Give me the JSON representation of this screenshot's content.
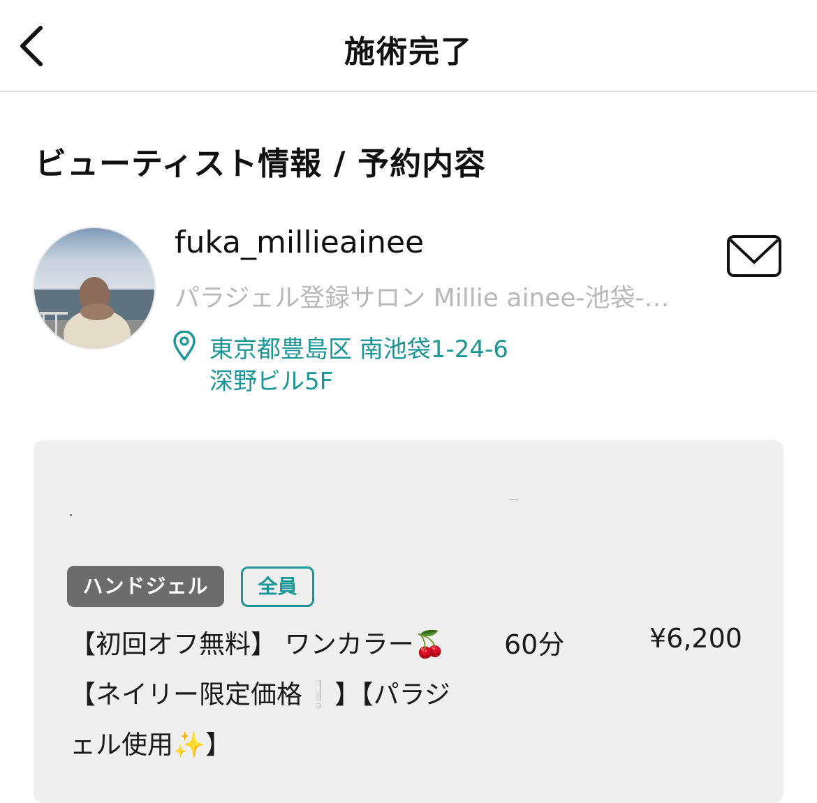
{
  "header": {
    "title": "施術完了",
    "back_icon": "chevron-left-icon"
  },
  "section": {
    "title": "ビューティスト情報 / 予約内容"
  },
  "stylist": {
    "username": "fuka_millieainee",
    "salon": "パラジェル登録サロン Millie ainee-池袋-…",
    "address_line1": "東京都豊島区 南池袋1-24-6",
    "address_line2": "深野ビル5F",
    "avatar_icon": "stylist-avatar-photo",
    "mail_icon": "envelope-icon",
    "location_icon": "map-pin-icon"
  },
  "booking": {
    "tags": [
      "ハンドジェル",
      "全員"
    ],
    "menu_lines": [
      "【初回オフ無料】 ワンカラー🍒",
      "【ネイリー限定価格❕】【パラジ",
      "ェル使用✨】"
    ],
    "duration": "60分",
    "price": "¥6,200"
  },
  "colors": {
    "accent": "#1b9596",
    "card_background": "#efefef",
    "tag_background": "#6c6c6c",
    "muted_text": "#b8b8b8"
  }
}
